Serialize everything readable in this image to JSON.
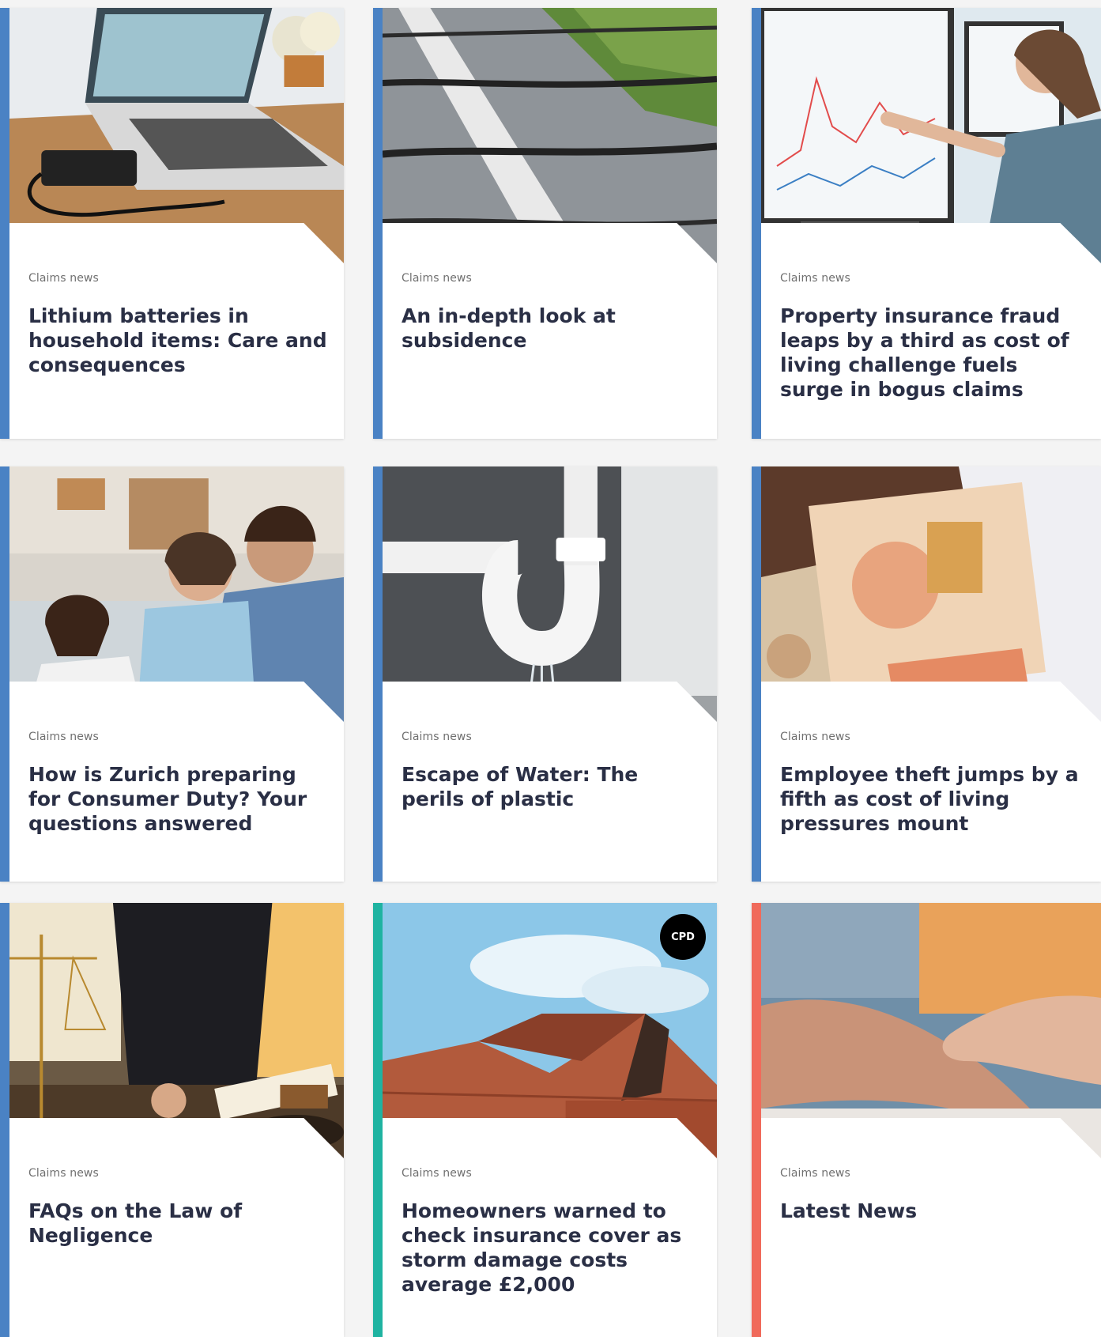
{
  "cards": [
    {
      "category": "Claims news",
      "headline": "Lithium batteries in household items: Care and consequences",
      "image_subject": "laptop with charger on wooden desk",
      "accent": "#4a82c4"
    },
    {
      "category": "Claims news",
      "headline": "An in-depth look at subsidence",
      "image_subject": "cracked road surface with grass",
      "accent": "#4a82c4"
    },
    {
      "category": "Claims news",
      "headline": "Property insurance fraud leaps by a third as cost of living challenge fuels surge in bogus claims",
      "image_subject": "woman pointing at computer monitor charts",
      "accent": "#4a82c4"
    },
    {
      "category": "Claims news",
      "headline": "How is Zurich preparing for Consumer Duty? Your questions answered",
      "image_subject": "laughing family on sofa",
      "accent": "#4a82c4"
    },
    {
      "category": "Claims news",
      "headline": "Escape of Water: The perils of plastic",
      "image_subject": "leaking white plastic pipe",
      "accent": "#4a82c4"
    },
    {
      "category": "Claims news",
      "headline": "Employee theft jumps by a fifth as cost of living pressures mount",
      "image_subject": "ten pound notes",
      "accent": "#4a82c4"
    },
    {
      "category": "Claims news",
      "headline": "FAQs on the Law of Negligence",
      "image_subject": "lawyer writing with scales of justice and gavel",
      "accent": "#4a82c4"
    },
    {
      "category": "Claims news",
      "headline": "Homeowners warned to check insurance cover as storm damage costs average £2,000",
      "image_subject": "storm damaged roof under blue sky",
      "accent": "#1fb3a1",
      "badge": "CPD"
    },
    {
      "category": "Claims news",
      "headline": "Latest News",
      "image_subject": "handshake",
      "accent": "#f06a5b"
    }
  ]
}
